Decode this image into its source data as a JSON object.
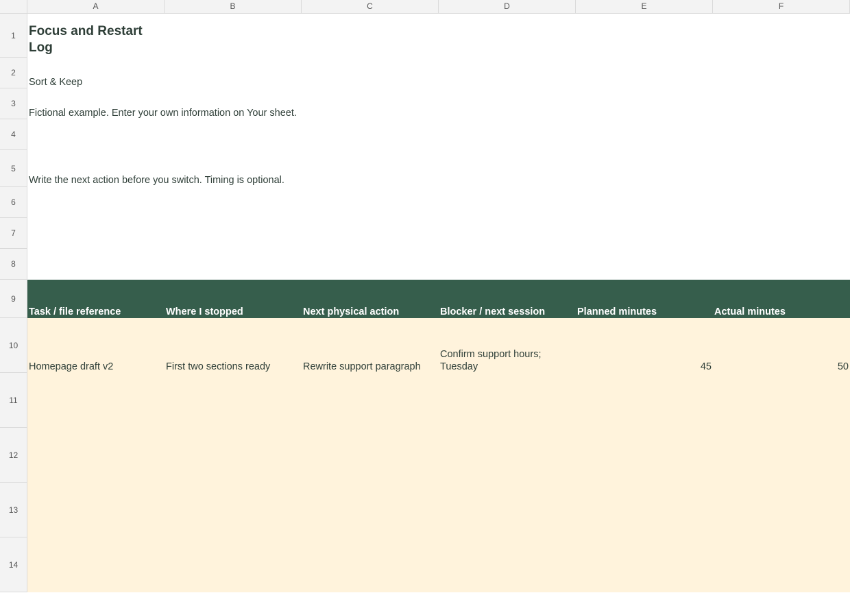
{
  "columns": [
    "A",
    "B",
    "C",
    "D",
    "E",
    "F"
  ],
  "rows": [
    "1",
    "2",
    "3",
    "4",
    "5",
    "6",
    "7",
    "8",
    "9",
    "10",
    "11",
    "12",
    "13",
    "14"
  ],
  "sheet": {
    "title": "Focus and Restart Log",
    "subtitle": "Sort & Keep",
    "note": "Fictional example. Enter your own information on Your sheet.",
    "instruction": "Write the next action before you switch. Timing is optional."
  },
  "table": {
    "headers": [
      "Task / file reference",
      "Where I stopped",
      "Next physical action",
      "Blocker / next session",
      "Planned minutes",
      "Actual minutes"
    ],
    "rows": [
      {
        "task": "Homepage draft v2",
        "stopped": "First two sections ready",
        "next_action": "Rewrite support paragraph",
        "blocker": "Confirm support hours; Tuesday",
        "planned": "45",
        "actual": "50"
      }
    ]
  },
  "colors": {
    "header_bg": "#365e4c",
    "data_bg": "#fff3dc",
    "text": "#2f3f38"
  }
}
